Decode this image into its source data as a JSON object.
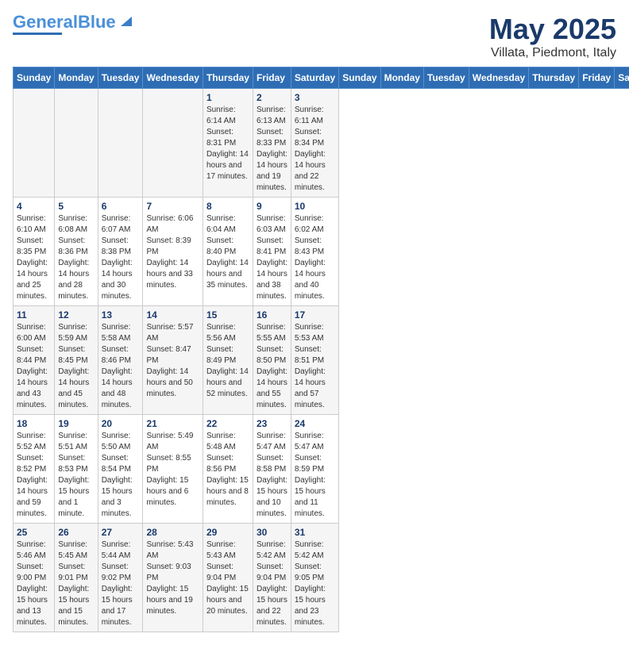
{
  "header": {
    "logo_general": "General",
    "logo_blue": "Blue",
    "month": "May 2025",
    "location": "Villata, Piedmont, Italy"
  },
  "weekdays": [
    "Sunday",
    "Monday",
    "Tuesday",
    "Wednesday",
    "Thursday",
    "Friday",
    "Saturday"
  ],
  "weeks": [
    [
      {
        "day": "",
        "info": ""
      },
      {
        "day": "",
        "info": ""
      },
      {
        "day": "",
        "info": ""
      },
      {
        "day": "",
        "info": ""
      },
      {
        "day": "1",
        "info": "Sunrise: 6:14 AM\nSunset: 8:31 PM\nDaylight: 14 hours and 17 minutes."
      },
      {
        "day": "2",
        "info": "Sunrise: 6:13 AM\nSunset: 8:33 PM\nDaylight: 14 hours and 19 minutes."
      },
      {
        "day": "3",
        "info": "Sunrise: 6:11 AM\nSunset: 8:34 PM\nDaylight: 14 hours and 22 minutes."
      }
    ],
    [
      {
        "day": "4",
        "info": "Sunrise: 6:10 AM\nSunset: 8:35 PM\nDaylight: 14 hours and 25 minutes."
      },
      {
        "day": "5",
        "info": "Sunrise: 6:08 AM\nSunset: 8:36 PM\nDaylight: 14 hours and 28 minutes."
      },
      {
        "day": "6",
        "info": "Sunrise: 6:07 AM\nSunset: 8:38 PM\nDaylight: 14 hours and 30 minutes."
      },
      {
        "day": "7",
        "info": "Sunrise: 6:06 AM\nSunset: 8:39 PM\nDaylight: 14 hours and 33 minutes."
      },
      {
        "day": "8",
        "info": "Sunrise: 6:04 AM\nSunset: 8:40 PM\nDaylight: 14 hours and 35 minutes."
      },
      {
        "day": "9",
        "info": "Sunrise: 6:03 AM\nSunset: 8:41 PM\nDaylight: 14 hours and 38 minutes."
      },
      {
        "day": "10",
        "info": "Sunrise: 6:02 AM\nSunset: 8:43 PM\nDaylight: 14 hours and 40 minutes."
      }
    ],
    [
      {
        "day": "11",
        "info": "Sunrise: 6:00 AM\nSunset: 8:44 PM\nDaylight: 14 hours and 43 minutes."
      },
      {
        "day": "12",
        "info": "Sunrise: 5:59 AM\nSunset: 8:45 PM\nDaylight: 14 hours and 45 minutes."
      },
      {
        "day": "13",
        "info": "Sunrise: 5:58 AM\nSunset: 8:46 PM\nDaylight: 14 hours and 48 minutes."
      },
      {
        "day": "14",
        "info": "Sunrise: 5:57 AM\nSunset: 8:47 PM\nDaylight: 14 hours and 50 minutes."
      },
      {
        "day": "15",
        "info": "Sunrise: 5:56 AM\nSunset: 8:49 PM\nDaylight: 14 hours and 52 minutes."
      },
      {
        "day": "16",
        "info": "Sunrise: 5:55 AM\nSunset: 8:50 PM\nDaylight: 14 hours and 55 minutes."
      },
      {
        "day": "17",
        "info": "Sunrise: 5:53 AM\nSunset: 8:51 PM\nDaylight: 14 hours and 57 minutes."
      }
    ],
    [
      {
        "day": "18",
        "info": "Sunrise: 5:52 AM\nSunset: 8:52 PM\nDaylight: 14 hours and 59 minutes."
      },
      {
        "day": "19",
        "info": "Sunrise: 5:51 AM\nSunset: 8:53 PM\nDaylight: 15 hours and 1 minute."
      },
      {
        "day": "20",
        "info": "Sunrise: 5:50 AM\nSunset: 8:54 PM\nDaylight: 15 hours and 3 minutes."
      },
      {
        "day": "21",
        "info": "Sunrise: 5:49 AM\nSunset: 8:55 PM\nDaylight: 15 hours and 6 minutes."
      },
      {
        "day": "22",
        "info": "Sunrise: 5:48 AM\nSunset: 8:56 PM\nDaylight: 15 hours and 8 minutes."
      },
      {
        "day": "23",
        "info": "Sunrise: 5:47 AM\nSunset: 8:58 PM\nDaylight: 15 hours and 10 minutes."
      },
      {
        "day": "24",
        "info": "Sunrise: 5:47 AM\nSunset: 8:59 PM\nDaylight: 15 hours and 11 minutes."
      }
    ],
    [
      {
        "day": "25",
        "info": "Sunrise: 5:46 AM\nSunset: 9:00 PM\nDaylight: 15 hours and 13 minutes."
      },
      {
        "day": "26",
        "info": "Sunrise: 5:45 AM\nSunset: 9:01 PM\nDaylight: 15 hours and 15 minutes."
      },
      {
        "day": "27",
        "info": "Sunrise: 5:44 AM\nSunset: 9:02 PM\nDaylight: 15 hours and 17 minutes."
      },
      {
        "day": "28",
        "info": "Sunrise: 5:43 AM\nSunset: 9:03 PM\nDaylight: 15 hours and 19 minutes."
      },
      {
        "day": "29",
        "info": "Sunrise: 5:43 AM\nSunset: 9:04 PM\nDaylight: 15 hours and 20 minutes."
      },
      {
        "day": "30",
        "info": "Sunrise: 5:42 AM\nSunset: 9:04 PM\nDaylight: 15 hours and 22 minutes."
      },
      {
        "day": "31",
        "info": "Sunrise: 5:42 AM\nSunset: 9:05 PM\nDaylight: 15 hours and 23 minutes."
      }
    ]
  ]
}
